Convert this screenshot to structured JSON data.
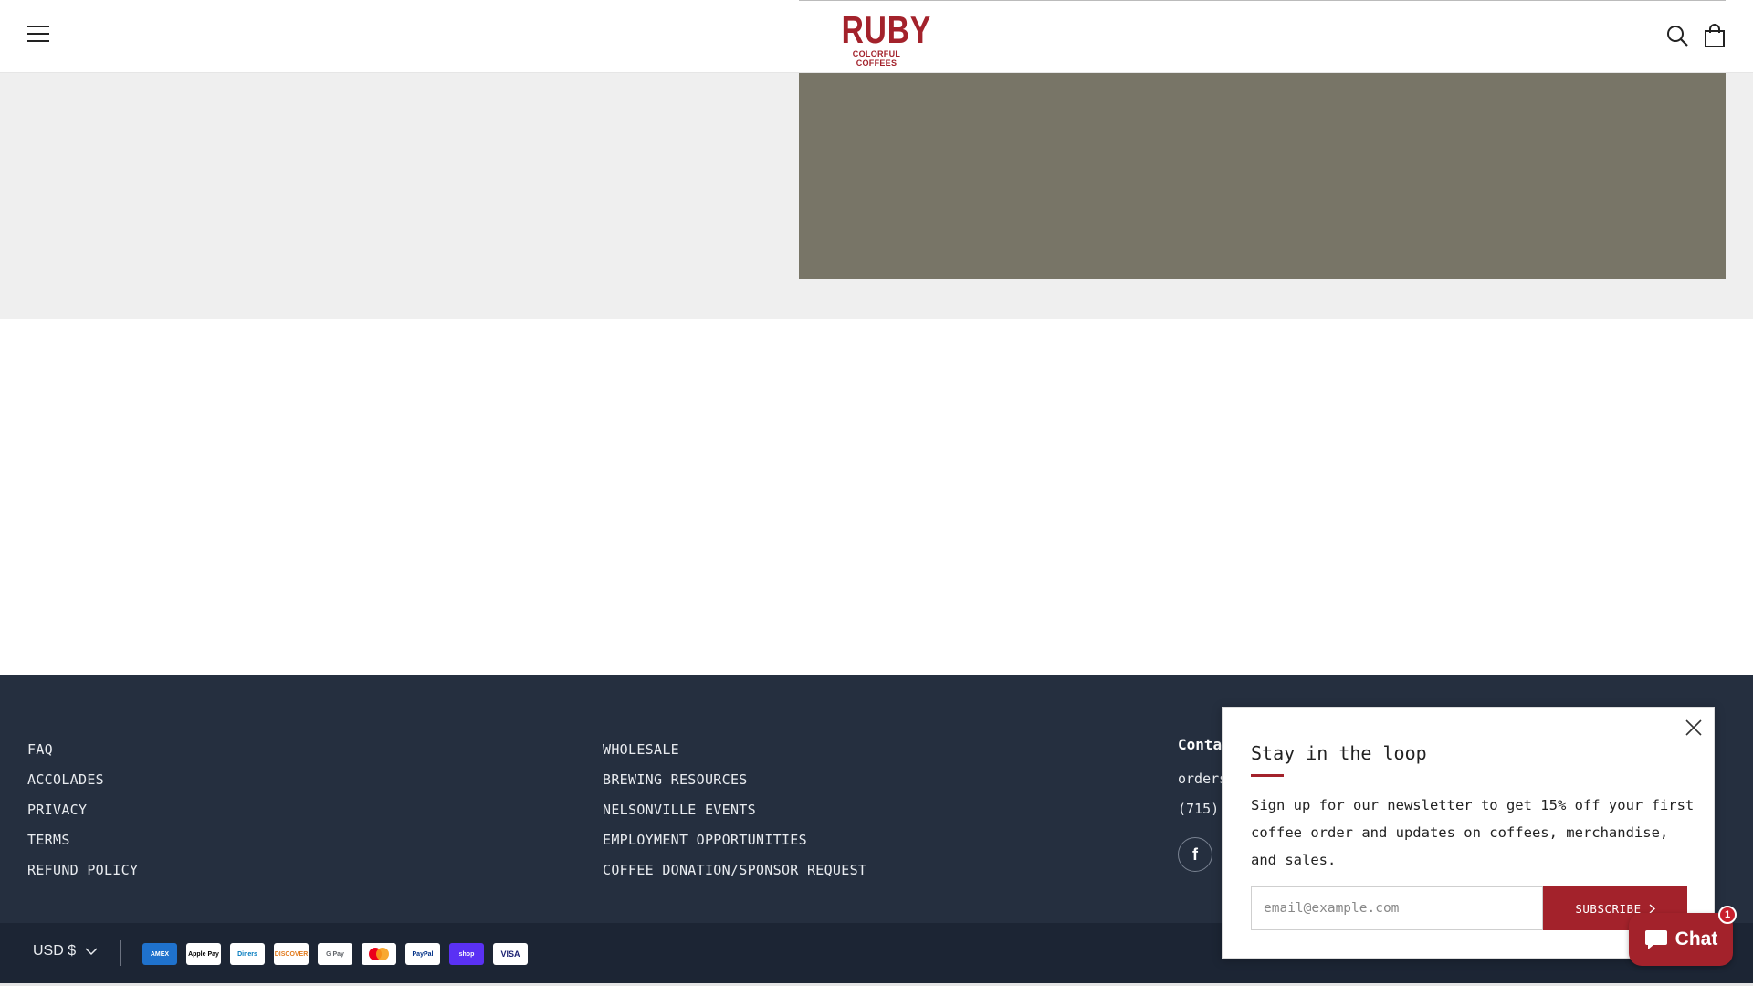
{
  "header": {
    "logo_main": "RUBY",
    "logo_sub": "COLORFUL COFFEES"
  },
  "footer": {
    "col1": [
      "FAQ",
      "ACCOLADES",
      "PRIVACY",
      "TERMS",
      "REFUND POLICY"
    ],
    "col2": [
      "WHOLESALE",
      "BREWING RESOURCES",
      "NELSONVILLE EVENTS",
      "EMPLOYMENT OPPORTUNITIES",
      "COFFEE DONATION/SPONSOR REQUEST"
    ],
    "contact": {
      "title": "Conta",
      "email": "orders",
      "phone": "(715)",
      "facebook_label": "f"
    },
    "currency": "USD $",
    "payments": [
      "AMEX",
      "Apple Pay",
      "Diners",
      "DISCOVER",
      "G Pay",
      "Mastercard",
      "PayPal",
      "shop",
      "VISA"
    ]
  },
  "popup": {
    "title": "Stay in the loop",
    "text": "Sign up for our newsletter to get 15% off your first coffee order and updates on coffees, merchandise, and sales.",
    "input_placeholder": "email@example.com",
    "subscribe_label": "SUBSCRIBE"
  },
  "chat": {
    "label": "Chat",
    "badge": "1"
  },
  "colors": {
    "brand": "#a3222b",
    "footer_bg": "#252f3f",
    "hero_image": "#787567"
  }
}
